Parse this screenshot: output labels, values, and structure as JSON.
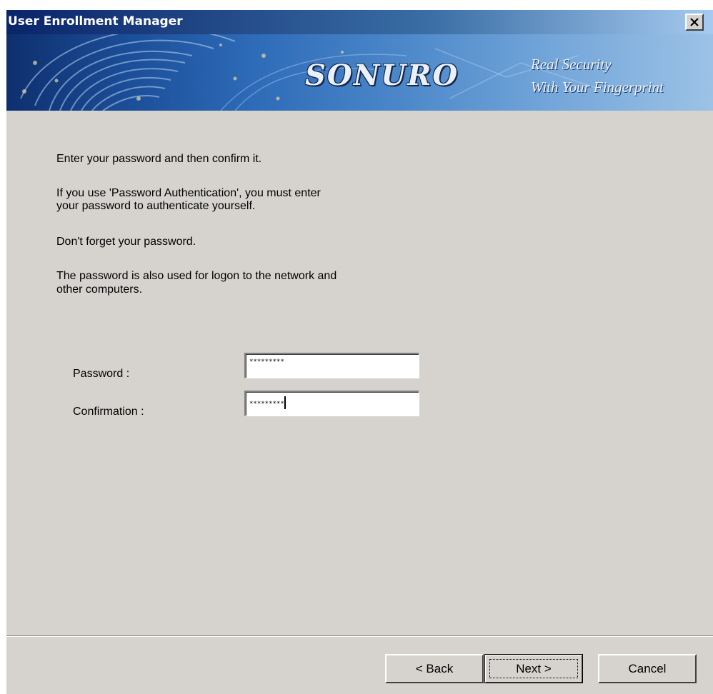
{
  "window": {
    "title": "User Enrollment Manager"
  },
  "banner": {
    "brand": "SONURO",
    "slogan_line1": "Real Security",
    "slogan_line2": "With Your  Fingerprint"
  },
  "instructions": {
    "line1": "Enter your password and then confirm it.",
    "line2a": "If you use 'Password Authentication',  you must enter",
    "line2b": "your password to authenticate yourself.",
    "line3": "Don't forget your password.",
    "line4a": "The password is also used for logon to the network and",
    "line4b": "other computers."
  },
  "form": {
    "password_label": "Password :",
    "password_value": "*********",
    "confirmation_label": "Confirmation :",
    "confirmation_value": "*********"
  },
  "buttons": {
    "back": "< Back",
    "next": "Next >",
    "cancel": "Cancel"
  },
  "colors": {
    "dialog_bg": "#d6d3ce",
    "titlebar_start": "#0a246a",
    "titlebar_end": "#a6caf0"
  }
}
